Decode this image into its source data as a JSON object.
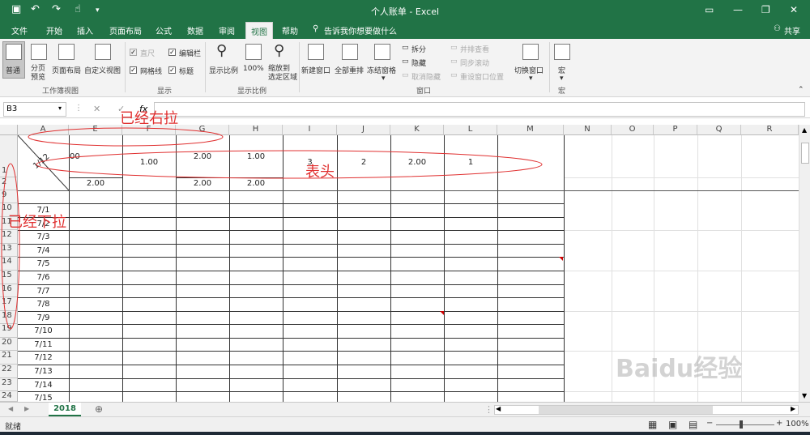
{
  "title": "个人账单 - Excel",
  "tabs": [
    "文件",
    "开始",
    "插入",
    "页面布局",
    "公式",
    "数据",
    "审阅",
    "视图",
    "帮助"
  ],
  "active_tab": "视图",
  "tell_me": "告诉我你想要做什么",
  "share": "共享",
  "ribbon": {
    "normal": "普通",
    "page_break": "分页\n预览",
    "page_layout": "页面布局",
    "custom_view": "自定义视图",
    "ruler": "直尺",
    "gridlines": "网格线",
    "formula_bar": "编辑栏",
    "headings": "标题",
    "zoom": "显示比例",
    "zoom100": "100%",
    "zoom_sel": "缩放到\n选定区域",
    "new_window": "新建窗口",
    "arrange_all": "全部重排",
    "freeze": "冻结窗格",
    "split": "拆分",
    "hide": "隐藏",
    "unhide": "取消隐藏",
    "side_by_side": "并排查看",
    "sync_scroll": "同步滚动",
    "reset_pos": "重设窗口位置",
    "switch_window": "切换窗口",
    "macros": "宏",
    "groups": [
      "工作簿视图",
      "显示",
      "显示比例",
      "窗口",
      "宏"
    ]
  },
  "name_box": "B3",
  "formula_icons": [
    "✕",
    "✓",
    "fx"
  ],
  "columns": [
    "A",
    "E",
    "F",
    "G",
    "H",
    "I",
    "J",
    "K",
    "L",
    "M",
    "N",
    "O",
    "P",
    "Q",
    "R"
  ],
  "rows": [
    "1",
    "2",
    "9",
    "10",
    "11",
    "12",
    "13",
    "14",
    "15",
    "16",
    "17",
    "18",
    "19",
    "20",
    "21",
    "22",
    "23",
    "24"
  ],
  "header_cells": {
    "a1": "1/12",
    "e1": "00",
    "f1": "1.00",
    "g1": "2.00",
    "h1": "1.00",
    "i1": "3",
    "j1": "2",
    "k1": "2.00",
    "l1": "1",
    "e2": "2.00",
    "g2": "2.00",
    "h2": "2.00"
  },
  "dates": [
    "7/1",
    "7/2",
    "7/3",
    "7/4",
    "7/5",
    "7/6",
    "7/7",
    "7/8",
    "7/9",
    "7/10",
    "7/11",
    "7/12",
    "7/13",
    "7/14",
    "7/15"
  ],
  "annotations": {
    "right": "已经右拉",
    "header": "表头",
    "down": "已经下拉"
  },
  "sheet_tab": "2018",
  "status": "就绪",
  "zoom_level": "100%",
  "watermark": "Baidu经验"
}
